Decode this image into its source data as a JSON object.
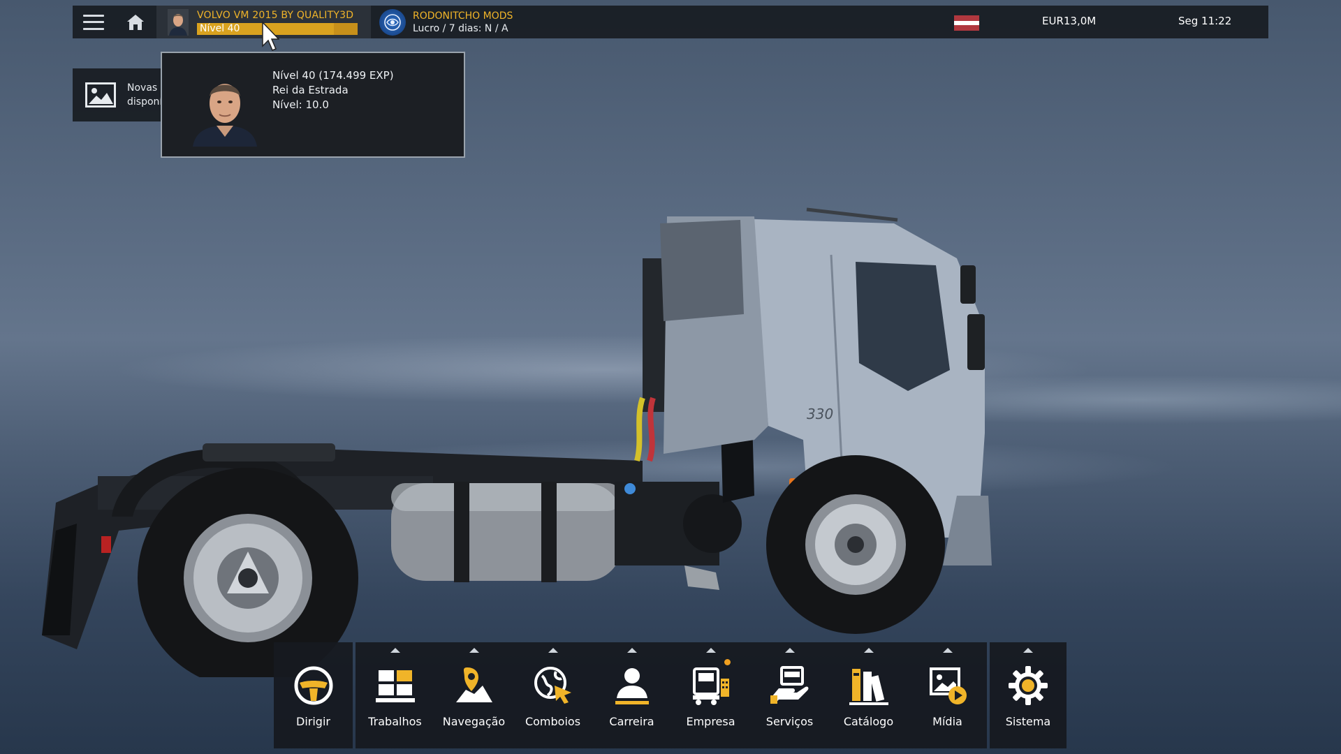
{
  "topbar": {
    "profile_name": "VOLVO VM 2015 BY QUALITY3D",
    "level_label": "Nível 40",
    "level_progress": 0.85,
    "company_name": "RODONITCHO MODS",
    "company_profit": "Lucro / 7 dias: N / A",
    "money": "EUR13,0M",
    "clock": "Seg 11:22",
    "icons": [
      "menu-icon",
      "home-icon",
      "flag-icon"
    ]
  },
  "notification": {
    "line1": "Novas imagens",
    "line2": "disponíveis no álbum"
  },
  "tooltip": {
    "line1": "Nível 40 (174.499 EXP)",
    "line2": "Rei da Estrada",
    "line3": "Nível: 10.0"
  },
  "truck": {
    "model_badge": "330"
  },
  "dock": {
    "drive": {
      "label": "Dirigir",
      "icon": "steering-wheel-icon"
    },
    "items": [
      {
        "label": "Trabalhos",
        "icon": "jobs-icon"
      },
      {
        "label": "Navegação",
        "icon": "map-pin-icon"
      },
      {
        "label": "Comboios",
        "icon": "globe-cursor-icon"
      },
      {
        "label": "Carreira",
        "icon": "person-icon"
      },
      {
        "label": "Empresa",
        "icon": "company-truck-icon"
      },
      {
        "label": "Serviços",
        "icon": "service-hand-icon"
      },
      {
        "label": "Catálogo",
        "icon": "books-icon"
      },
      {
        "label": "Mídia",
        "icon": "media-icon"
      }
    ],
    "system": {
      "label": "Sistema",
      "icon": "gear-icon"
    }
  },
  "colors": {
    "accent": "#f0b429",
    "bar_bg": "#181c22",
    "profile_bg": "#2b3139"
  }
}
